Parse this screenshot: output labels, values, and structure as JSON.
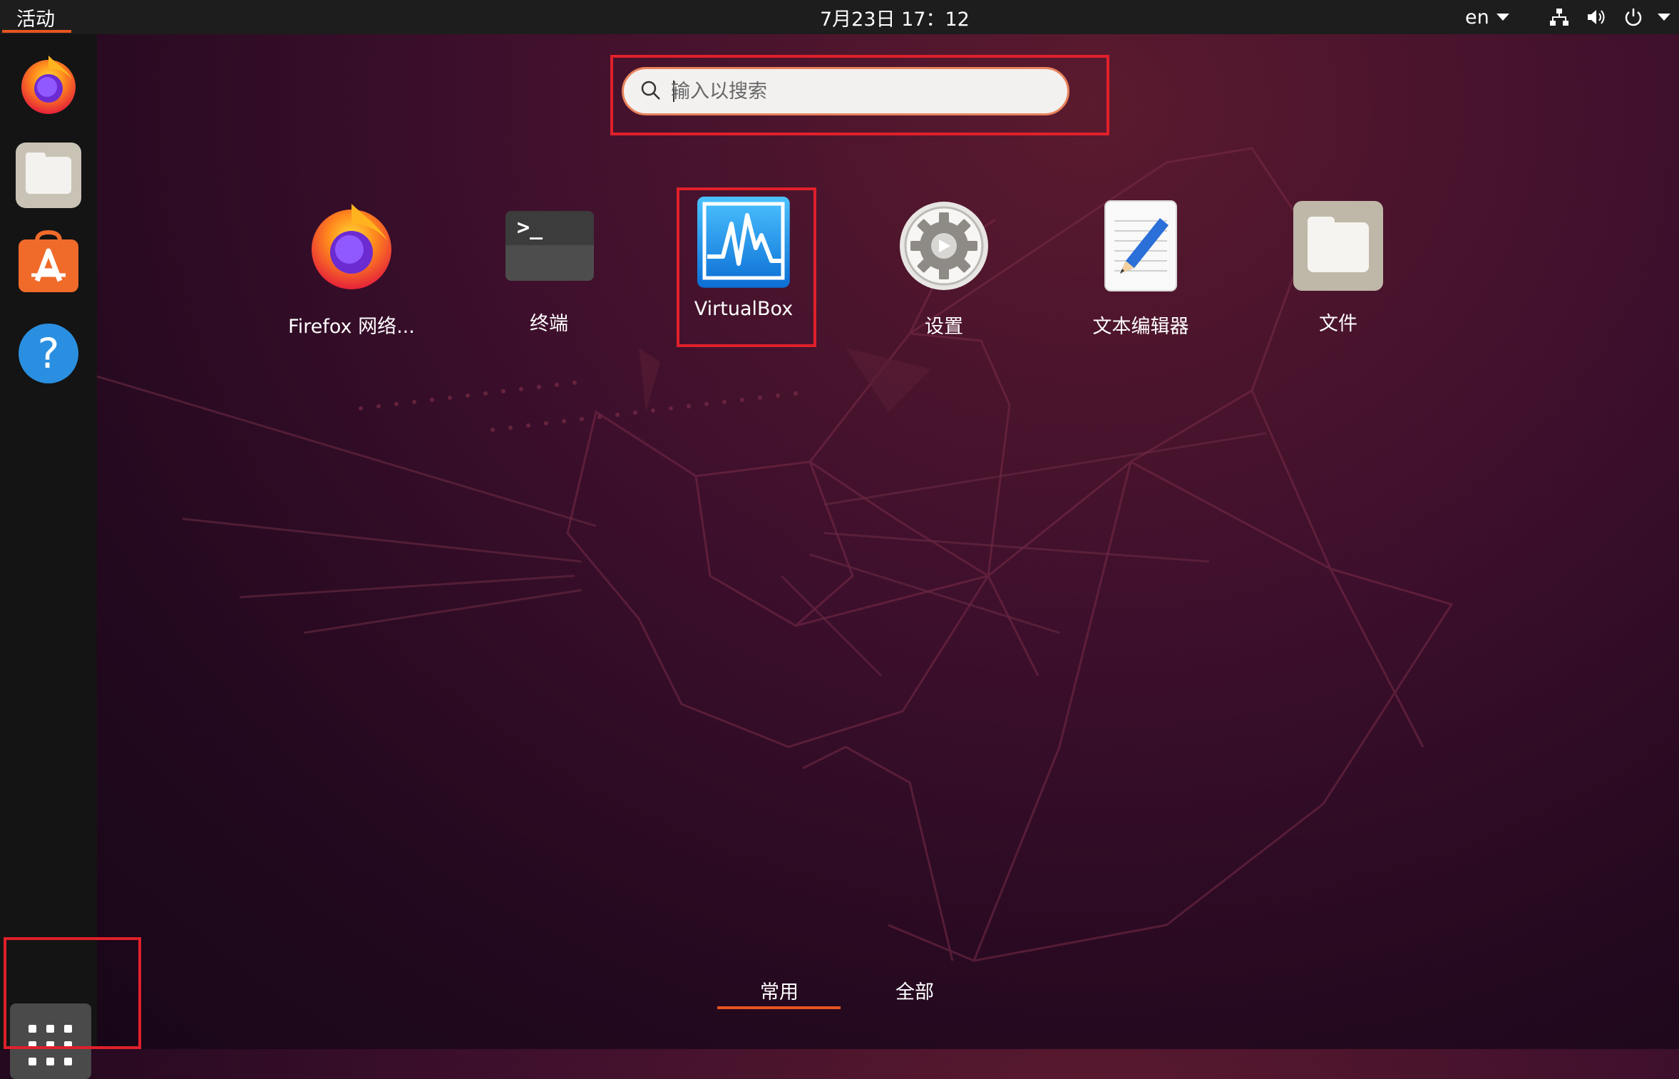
{
  "topbar": {
    "activities": "活动",
    "clock": "7月23日  17：12",
    "lang": "en",
    "tray": [
      "network-icon",
      "volume-icon",
      "power-icon"
    ]
  },
  "dock": {
    "apps": [
      {
        "name": "Firefox",
        "icon": "firefox-icon"
      },
      {
        "name": "Files",
        "icon": "files-icon"
      },
      {
        "name": "Ubuntu Software",
        "icon": "software-icon"
      },
      {
        "name": "Help",
        "icon": "help-icon"
      }
    ],
    "show_apps_icon": "grid-icon"
  },
  "search": {
    "placeholder": "输入以搜索"
  },
  "apps": [
    {
      "label": "Firefox 网络...",
      "icon": "firefox-icon"
    },
    {
      "label": "终端",
      "icon": "terminal-icon"
    },
    {
      "label": "VirtualBox",
      "icon": "virtualbox-icon"
    },
    {
      "label": "设置",
      "icon": "settings-icon"
    },
    {
      "label": "文本编辑器",
      "icon": "text-editor-icon"
    },
    {
      "label": "文件",
      "icon": "files-icon"
    }
  ],
  "tabs": {
    "frequent": "常用",
    "all": "全部"
  },
  "colors": {
    "accent": "#e95420",
    "highlight": "#e0202a",
    "topbar": "#1d1d1d"
  }
}
